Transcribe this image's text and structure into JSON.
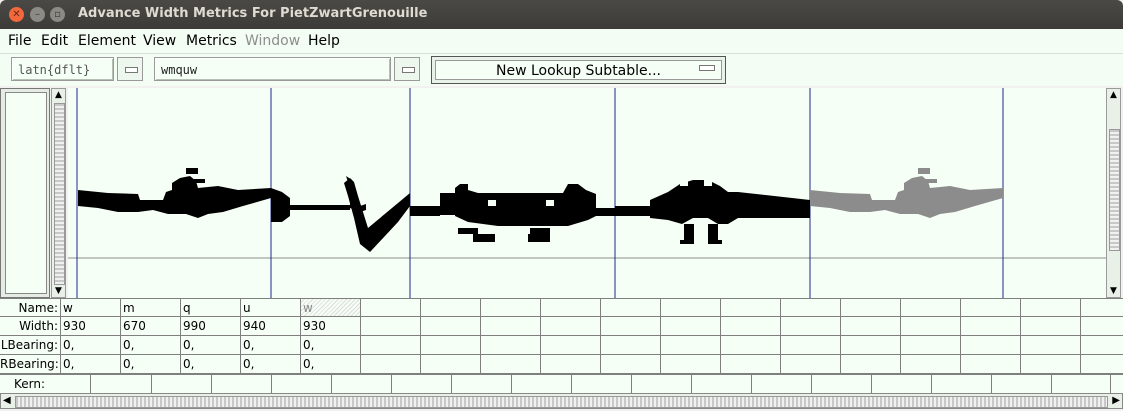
{
  "window": {
    "title": "Advance Width Metrics For PietZwartGrenouille",
    "close_glyph": "✕",
    "min_glyph": "–",
    "max_glyph": "▫"
  },
  "menu": [
    {
      "label": "File",
      "enabled": true
    },
    {
      "label": "Edit",
      "enabled": true
    },
    {
      "label": "Element",
      "enabled": true
    },
    {
      "label": "View",
      "enabled": true
    },
    {
      "label": "Metrics",
      "enabled": true
    },
    {
      "label": "Window",
      "enabled": false
    },
    {
      "label": "Help",
      "enabled": true
    }
  ],
  "toolbar": {
    "script_value": "latn{dflt}",
    "text_value": "wmquw",
    "lookup_label": "New Lookup Subtable..."
  },
  "table": {
    "row_labels": {
      "name": "Name:",
      "width": "Width:",
      "lbearing": "LBearing:",
      "rbearing": "RBearing:",
      "kern": "Kern:"
    },
    "glyphs": [
      {
        "name": "w",
        "width": "930",
        "lbearing": "0,",
        "rbearing": "0,"
      },
      {
        "name": "m",
        "width": "670",
        "lbearing": "0,",
        "rbearing": "0,"
      },
      {
        "name": "q",
        "width": "990",
        "lbearing": "0,",
        "rbearing": "0,"
      },
      {
        "name": "u",
        "width": "940",
        "lbearing": "0,",
        "rbearing": "0,"
      },
      {
        "name": "w",
        "width": "930",
        "lbearing": "0,",
        "rbearing": "0,"
      }
    ]
  },
  "colors": {
    "glyph_fill": "#000000",
    "preview_glyph_fill": "#8c8c8c",
    "advance_line": "#1f2a8c",
    "baseline": "#8c8c8c"
  }
}
